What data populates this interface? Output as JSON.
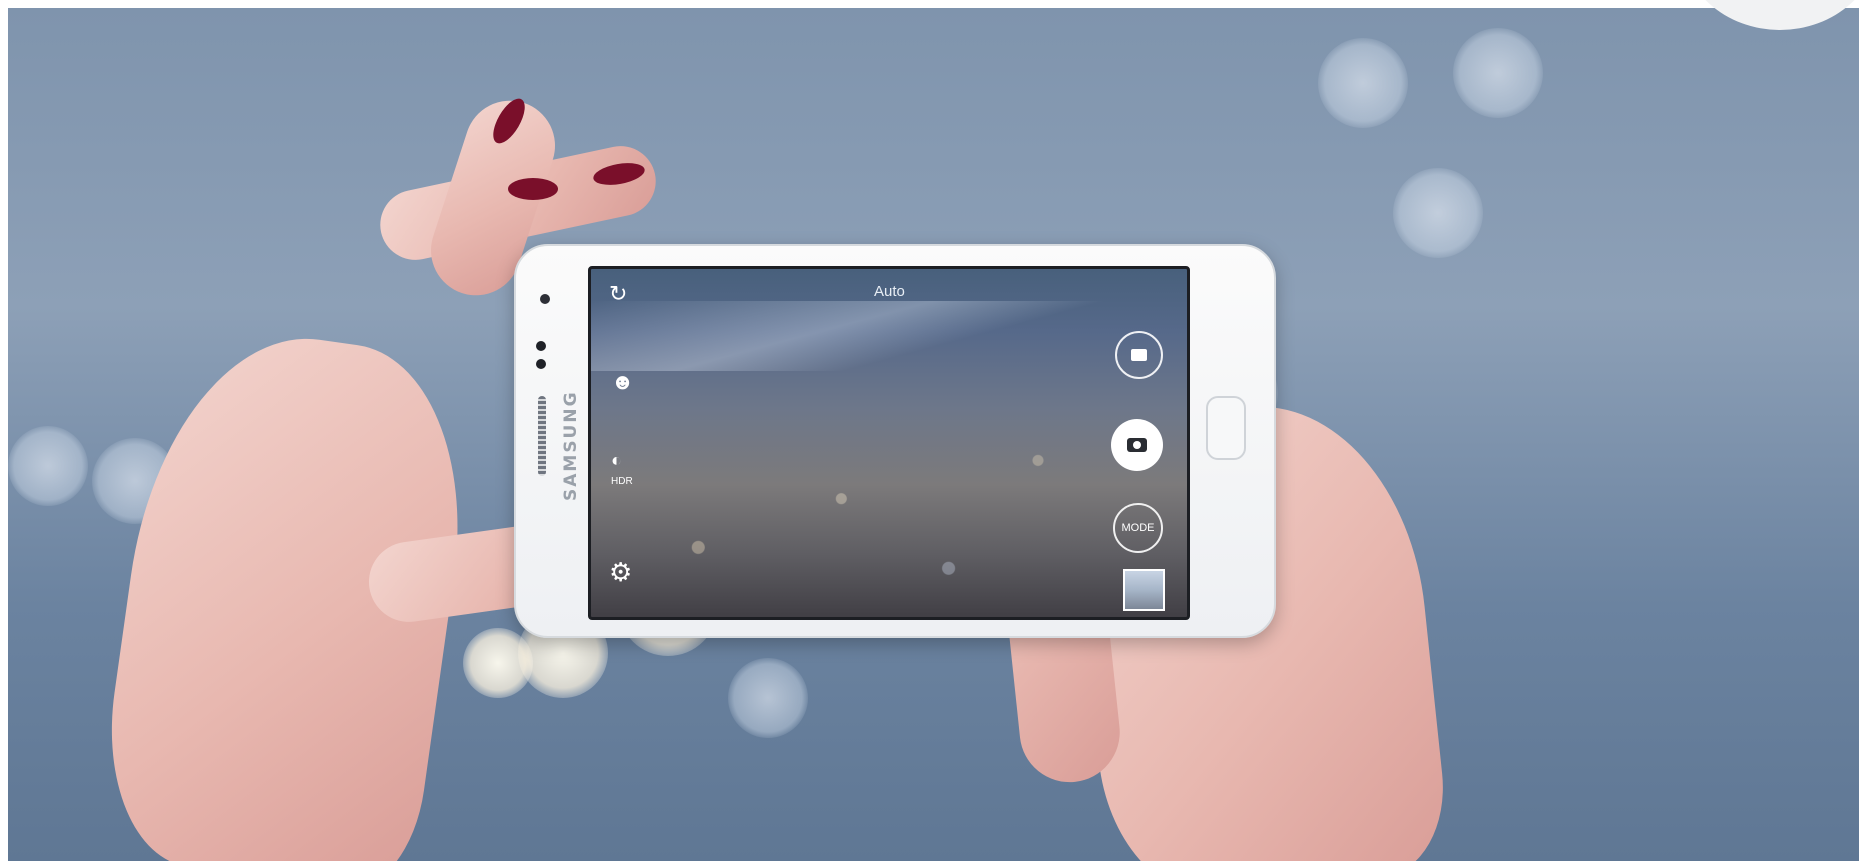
{
  "photo": {
    "subject": "",
    "phone": {
      "brand": "SAMSUNG",
      "camera_ui": {
        "mode_label": "Auto",
        "hdr_label": "HDR",
        "mode_button_label": "MODE",
        "icons": [
          "camera-switch-icon",
          "selfie-icon",
          "hdr-icon",
          "settings-icon",
          "video-record-icon",
          "shutter-icon",
          "gallery-thumbnail"
        ]
      }
    },
    "colors": {
      "background": "#8da0b7",
      "nail_polish": "#7a0f2a",
      "phone_body": "#f5f6f8"
    }
  }
}
